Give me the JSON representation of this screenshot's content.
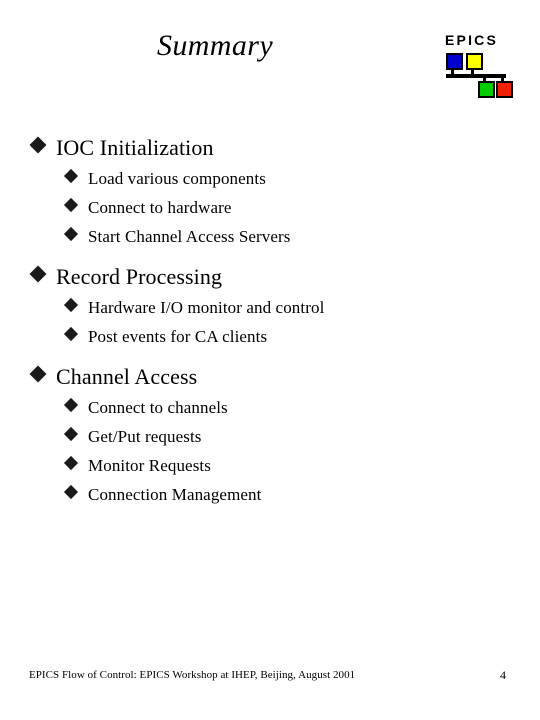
{
  "slide": {
    "title": "Summary",
    "page_number": "4",
    "footer_text": "EPICS Flow of Control: EPICS Workshop at IHEP, Beijing, August 2001",
    "background_color": "#ffffff",
    "text_color": "#000000"
  },
  "logo": {
    "wordmark": "EPICS",
    "nodes": [
      {
        "name": "blue-node",
        "color": "#0000cc"
      },
      {
        "name": "yellow-node",
        "color": "#ffff00"
      },
      {
        "name": "green-node",
        "color": "#00cc00"
      },
      {
        "name": "red-node",
        "color": "#ee2200"
      }
    ],
    "bus_color": "#000000"
  },
  "outline": {
    "bullet_glyph": "diamond",
    "sections": [
      {
        "heading": "IOC Initialization",
        "items": [
          "Load various components",
          "Connect to hardware",
          "Start Channel Access Servers"
        ]
      },
      {
        "heading": "Record Processing",
        "items": [
          "Hardware I/O monitor and control",
          "Post events for CA clients"
        ]
      },
      {
        "heading": "Channel Access",
        "items": [
          "Connect to channels",
          "Get/Put requests",
          "Monitor Requests",
          "Connection Management"
        ]
      }
    ]
  }
}
